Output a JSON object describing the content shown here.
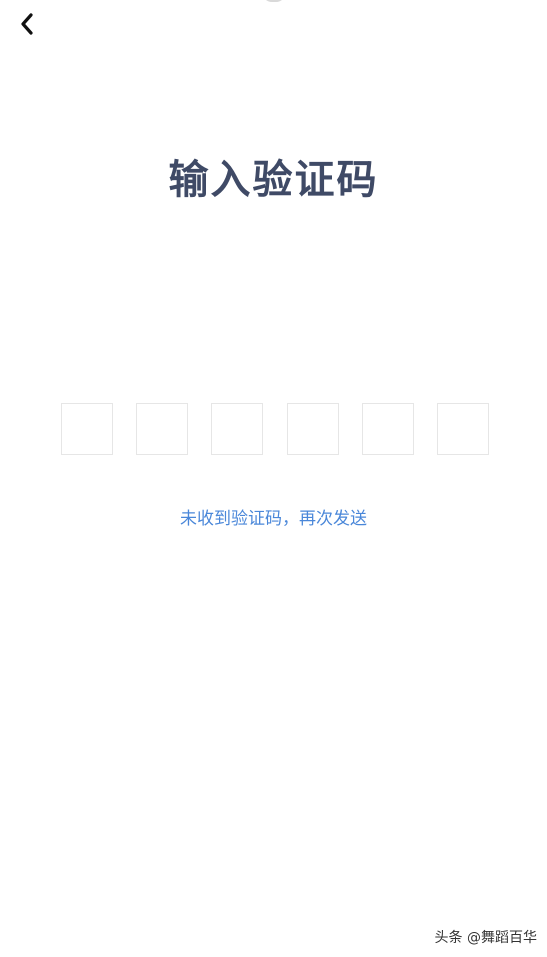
{
  "icons": {
    "back": "chevron-left-icon"
  },
  "title": "输入验证码",
  "code_inputs": {
    "count": 6
  },
  "resend_link": "未收到验证码，再次发送",
  "watermark": "头条 @舞蹈百华",
  "colors": {
    "title": "#3f4a66",
    "link": "#4a87d9",
    "box_border": "#e6e6e6",
    "background": "#ffffff"
  }
}
